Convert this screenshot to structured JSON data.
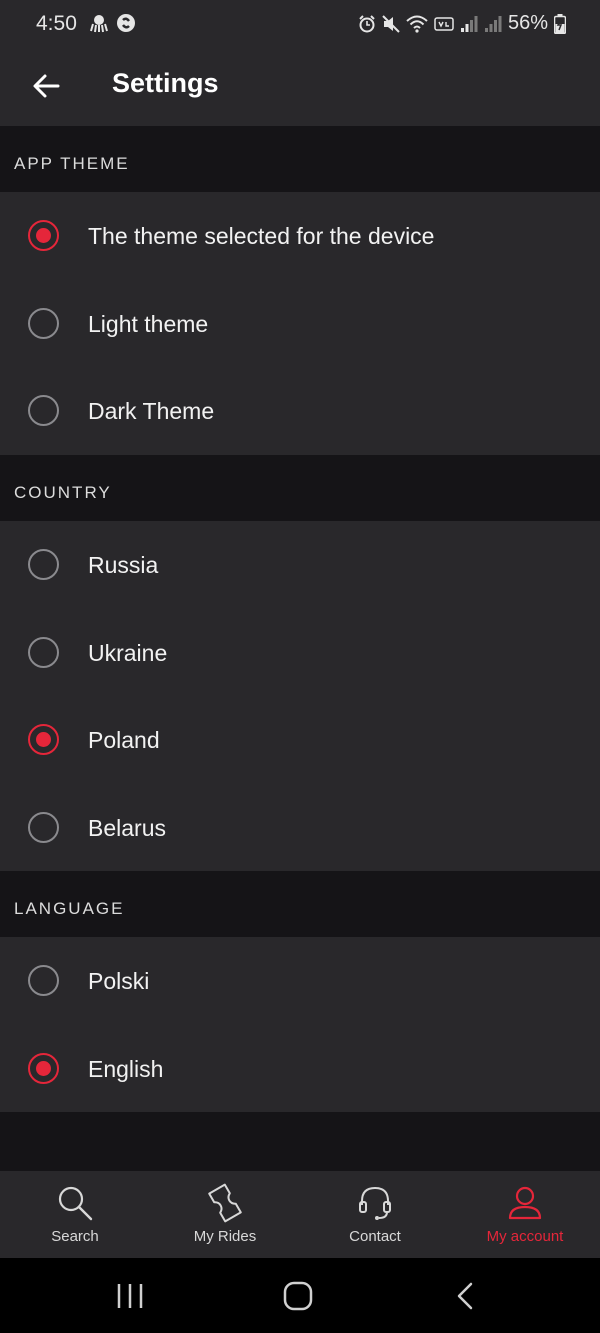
{
  "status_bar": {
    "time": "4:50",
    "battery": "56%",
    "icons": [
      "octopus-icon",
      "shazam-icon",
      "alarm-icon",
      "mute-icon",
      "wifi-icon",
      "volte-icon",
      "signal-icon",
      "signal-icon",
      "battery-charging-icon"
    ]
  },
  "header": {
    "title": "Settings",
    "back_icon": "arrow-left-icon"
  },
  "sections": {
    "app_theme": {
      "title": "APP THEME",
      "options": [
        {
          "label": "The theme selected for the device",
          "selected": true
        },
        {
          "label": "Light theme",
          "selected": false
        },
        {
          "label": "Dark Theme",
          "selected": false
        }
      ]
    },
    "country": {
      "title": "COUNTRY",
      "options": [
        {
          "label": "Russia",
          "selected": false
        },
        {
          "label": "Ukraine",
          "selected": false
        },
        {
          "label": "Poland",
          "selected": true
        },
        {
          "label": "Belarus",
          "selected": false
        }
      ]
    },
    "language": {
      "title": "LANGUAGE",
      "options": [
        {
          "label": "Polski",
          "selected": false
        },
        {
          "label": "English",
          "selected": true
        }
      ]
    }
  },
  "bottom_nav": {
    "items": [
      {
        "label": "Search",
        "icon": "search-icon",
        "active": false
      },
      {
        "label": "My Rides",
        "icon": "ticket-icon",
        "active": false
      },
      {
        "label": "Contact",
        "icon": "headset-icon",
        "active": false
      },
      {
        "label": "My account",
        "icon": "user-icon",
        "active": true
      }
    ]
  },
  "system_nav": [
    "recent-apps-icon",
    "home-icon",
    "back-icon"
  ],
  "colors": {
    "accent": "#e5263a",
    "surface": "#29282b",
    "background": "#151417",
    "radio_unchecked": "#8a8a8e"
  }
}
